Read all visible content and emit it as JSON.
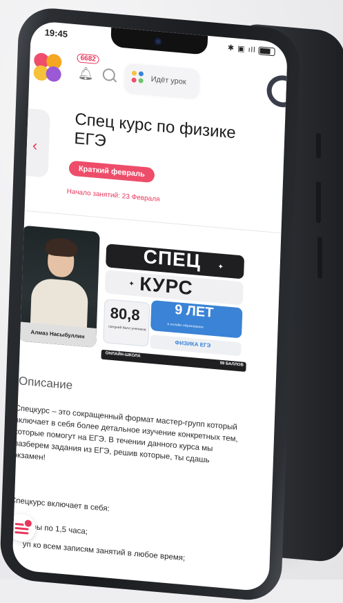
{
  "status": {
    "time": "19:45",
    "icons": "✱ ▣ ıll"
  },
  "header": {
    "badge_count": "6682",
    "lesson_label": "Идёт урок"
  },
  "course": {
    "title": "Спец курс по физике ЕГЭ",
    "tag": "Краткий февраль",
    "start": "Начало занятий: 23 Февраля"
  },
  "banner": {
    "teacher": "Алмаз Насыбуллин",
    "line1": "СПЕЦ",
    "line2": "КУРС",
    "score": "80,8",
    "score_label": "средний балл учеников",
    "years": "9 ЛЕТ",
    "years_label": "в онлайн-образовании",
    "subject": "ФИЗИКА ЕГЭ",
    "footer_left": "ОНЛАЙН-ШКОЛА",
    "footer_right": "99 БАЛЛОВ"
  },
  "description": {
    "heading": "Описание",
    "text": "Спецкурс – это сокращенный формат мастер-групп который включает в себя более детальное изучение конкретных тем, которые помогут на ЕГЭ. В течении данного курса мы разберем задания из ЕГЭ, решив которые, ты сдашь экзамен!",
    "includes": "Спецкурс включает в себя:",
    "item1": "нары по 1,5 часа;",
    "item2": "уп ко всем записям занятий в любое время;"
  },
  "colors": {
    "accent": "#e8355a",
    "blue": "#3a83d6"
  }
}
